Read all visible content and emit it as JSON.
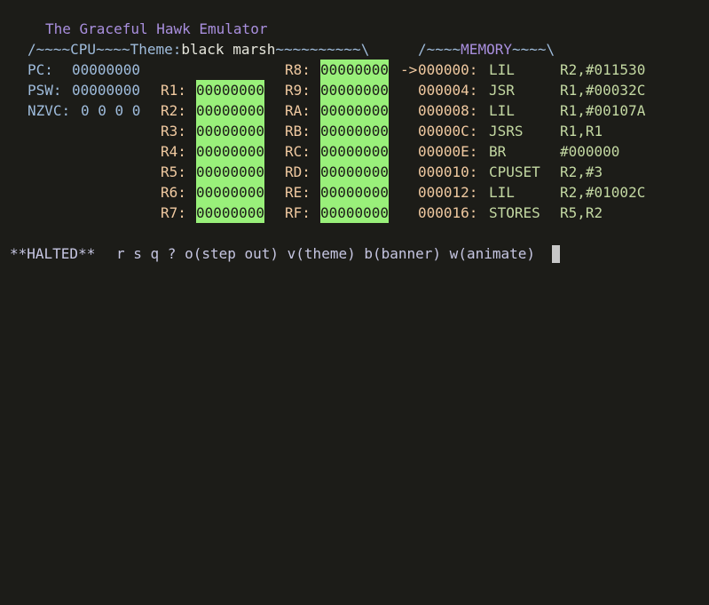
{
  "title": "The Graceful Hawk Emulator",
  "cpu_header": {
    "prefix": "/~~~~CPU~~~~Theme:",
    "theme": "black marsh",
    "suffix": "~~~~~~~~~~\\"
  },
  "memory_header": {
    "prefix": "/~~~~",
    "label": "MEMORY",
    "suffix": "~~~~\\"
  },
  "cpu": {
    "pc_label": "PC:",
    "pc_value": "00000000",
    "psw_label": "PSW:",
    "psw_value": "00000000",
    "nzvc_label": "NZVC:",
    "nzvc_value": "0 0 0 0"
  },
  "registers_left": [
    {
      "label": "R1:",
      "value": "00000000"
    },
    {
      "label": "R2:",
      "value": "00000000"
    },
    {
      "label": "R3:",
      "value": "00000000"
    },
    {
      "label": "R4:",
      "value": "00000000"
    },
    {
      "label": "R5:",
      "value": "00000000"
    },
    {
      "label": "R6:",
      "value": "00000000"
    },
    {
      "label": "R7:",
      "value": "00000000"
    }
  ],
  "registers_right": [
    {
      "label": "R8:",
      "value": "00000000"
    },
    {
      "label": "R9:",
      "value": "00000000"
    },
    {
      "label": "RA:",
      "value": "00000000"
    },
    {
      "label": "RB:",
      "value": "00000000"
    },
    {
      "label": "RC:",
      "value": "00000000"
    },
    {
      "label": "RD:",
      "value": "00000000"
    },
    {
      "label": "RE:",
      "value": "00000000"
    },
    {
      "label": "RF:",
      "value": "00000000"
    }
  ],
  "memory": {
    "pointer": "->",
    "rows": [
      {
        "addr": "000000:",
        "op": "LIL",
        "args": "R2,#011530"
      },
      {
        "addr": "000004:",
        "op": "JSR",
        "args": "R1,#00032C"
      },
      {
        "addr": "000008:",
        "op": "LIL",
        "args": "R1,#00107A"
      },
      {
        "addr": "00000C:",
        "op": "JSRS",
        "args": "R1,R1"
      },
      {
        "addr": "00000E:",
        "op": "BR",
        "args": "#000000"
      },
      {
        "addr": "000010:",
        "op": "CPUSET",
        "args": "R2,#3"
      },
      {
        "addr": "000012:",
        "op": "LIL",
        "args": "R2,#01002C"
      },
      {
        "addr": "000016:",
        "op": "STORES",
        "args": "R5,R2"
      }
    ]
  },
  "status": {
    "state": "**HALTED**",
    "commands": "r s q ? o(step out) v(theme) b(banner) w(animate)"
  }
}
